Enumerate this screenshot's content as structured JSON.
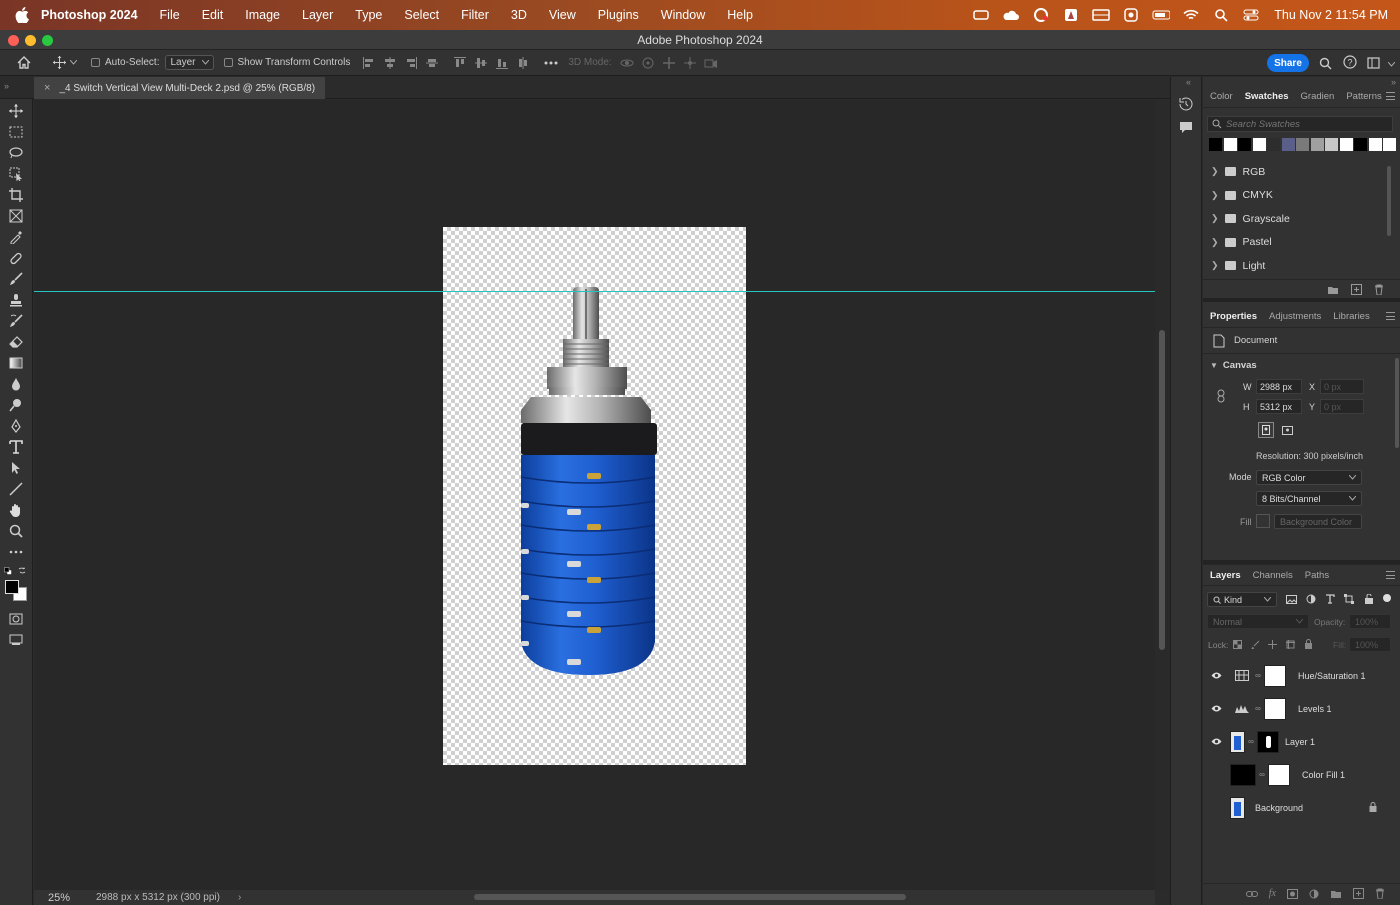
{
  "menubar": {
    "app_name": "Photoshop 2024",
    "items": [
      "File",
      "Edit",
      "Image",
      "Layer",
      "Type",
      "Select",
      "Filter",
      "3D",
      "View",
      "Plugins",
      "Window",
      "Help"
    ],
    "clock": "Thu Nov 2  11:54 PM"
  },
  "window": {
    "title": "Adobe Photoshop 2024"
  },
  "options": {
    "auto_select_label": "Auto-Select:",
    "auto_select_value": "Layer",
    "show_transform_label": "Show Transform Controls",
    "mode_3d_label": "3D Mode:",
    "share_label": "Share"
  },
  "document": {
    "tab_title": "_4 Switch Vertical View Multi-Deck 2.psd @ 25% (RGB/8)",
    "close_glyph": "×"
  },
  "status": {
    "zoom": "25%",
    "info": "2988 px x 5312 px (300 ppi)",
    "arrow": "›"
  },
  "swatches_panel": {
    "tabs": [
      "Color",
      "Swatches",
      "Gradien",
      "Patterns"
    ],
    "active_tab": "Swatches",
    "search_placeholder": "Search Swatches",
    "recent_colors": [
      "#000000",
      "#ffffff",
      "#000000",
      "#ffffff",
      "#2d2d2d",
      "#5a5f8a",
      "#7a7a7a",
      "#a0a0a0",
      "#c8c8c8",
      "#ffffff",
      "#000000",
      "#ffffff",
      "#ffffff"
    ],
    "groups": [
      "RGB",
      "CMYK",
      "Grayscale",
      "Pastel",
      "Light"
    ]
  },
  "properties_panel": {
    "tabs": [
      "Properties",
      "Adjustments",
      "Libraries"
    ],
    "active_tab": "Properties",
    "doc_label": "Document",
    "canvas_label": "Canvas",
    "w_label": "W",
    "w_value": "2988 px",
    "h_label": "H",
    "h_value": "5312 px",
    "x_label": "X",
    "x_placeholder": "0 px",
    "y_label": "Y",
    "y_placeholder": "0 px",
    "resolution": "Resolution: 300 pixels/inch",
    "mode_label": "Mode",
    "mode_value": "RGB Color",
    "bits_value": "8 Bits/Channel",
    "fill_label": "Fill",
    "fill_value": "Background Color"
  },
  "layers_panel": {
    "tabs": [
      "Layers",
      "Channels",
      "Paths"
    ],
    "active_tab": "Layers",
    "filter_kind": "Kind",
    "blend_mode": "Normal",
    "opacity_label": "Opacity:",
    "opacity_value": "100%",
    "lock_label": "Lock:",
    "fill_label": "Fill:",
    "fill_value": "100%",
    "layers": [
      {
        "name": "Hue/Saturation 1",
        "visible": true,
        "kind": "adjustment-hue"
      },
      {
        "name": "Levels 1",
        "visible": true,
        "kind": "adjustment-levels"
      },
      {
        "name": "Layer 1",
        "visible": true,
        "kind": "pixel"
      },
      {
        "name": "Color Fill 1",
        "visible": false,
        "kind": "fill"
      },
      {
        "name": "Background",
        "visible": false,
        "kind": "background",
        "locked": true
      }
    ]
  },
  "colors": {
    "accent": "#1473e6",
    "guide": "#27c3c3",
    "switch_blue": "#1f5fd1"
  }
}
